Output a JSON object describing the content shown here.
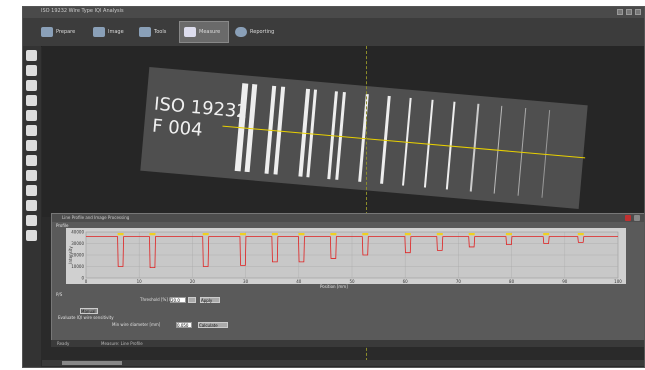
{
  "window": {
    "title": "ISO 19232 Wire Type IQI Analysis"
  },
  "toolbar": {
    "tabs": [
      {
        "label": "Prepare",
        "active": false
      },
      {
        "label": "Image",
        "active": false
      },
      {
        "label": "Tools",
        "active": false
      },
      {
        "label": "Measure",
        "active": true
      },
      {
        "label": "Reporting",
        "active": false
      }
    ]
  },
  "image": {
    "line1": "ISO 19232",
    "line2": "F 004",
    "scanline_color": "#e8d000"
  },
  "panel": {
    "title": "Line Profile and Image Processing",
    "plot_title": "Profile",
    "xlabel": "Position [mm]",
    "ylabel": "Intensity",
    "threshold_label": "Threshold [%] Limit",
    "threshold_value": "20.0",
    "apply_label": "Apply",
    "mode_tab": "Manual",
    "option_label": "Evaluate IQI wire sensitivity",
    "diameter_label": "Min wire diameter [mm]",
    "diameter_value": "0.050",
    "calc_label": "Calculate"
  },
  "status": {
    "left": "Ready",
    "right": "Measure: Line Profile"
  },
  "chart_data": {
    "type": "line",
    "title": "",
    "xlabel": "Position [mm]",
    "ylabel": "Intensity",
    "ylim": [
      0,
      40000
    ],
    "xlim": [
      0,
      100
    ],
    "grid": true,
    "dips": [
      {
        "x": 6.5,
        "depth": 26000
      },
      {
        "x": 12.5,
        "depth": 27000
      },
      {
        "x": 22.5,
        "depth": 26000
      },
      {
        "x": 29.5,
        "depth": 25000
      },
      {
        "x": 35.5,
        "depth": 22000
      },
      {
        "x": 40.5,
        "depth": 22000
      },
      {
        "x": 46.5,
        "depth": 19000
      },
      {
        "x": 52.5,
        "depth": 16000
      },
      {
        "x": 60.5,
        "depth": 14000
      },
      {
        "x": 66.5,
        "depth": 12000
      },
      {
        "x": 72.5,
        "depth": 9000
      },
      {
        "x": 79.5,
        "depth": 7000
      },
      {
        "x": 86.5,
        "depth": 6000
      },
      {
        "x": 93.0,
        "depth": 5000
      }
    ],
    "baseline": 36000,
    "line_color": "#e02020"
  }
}
